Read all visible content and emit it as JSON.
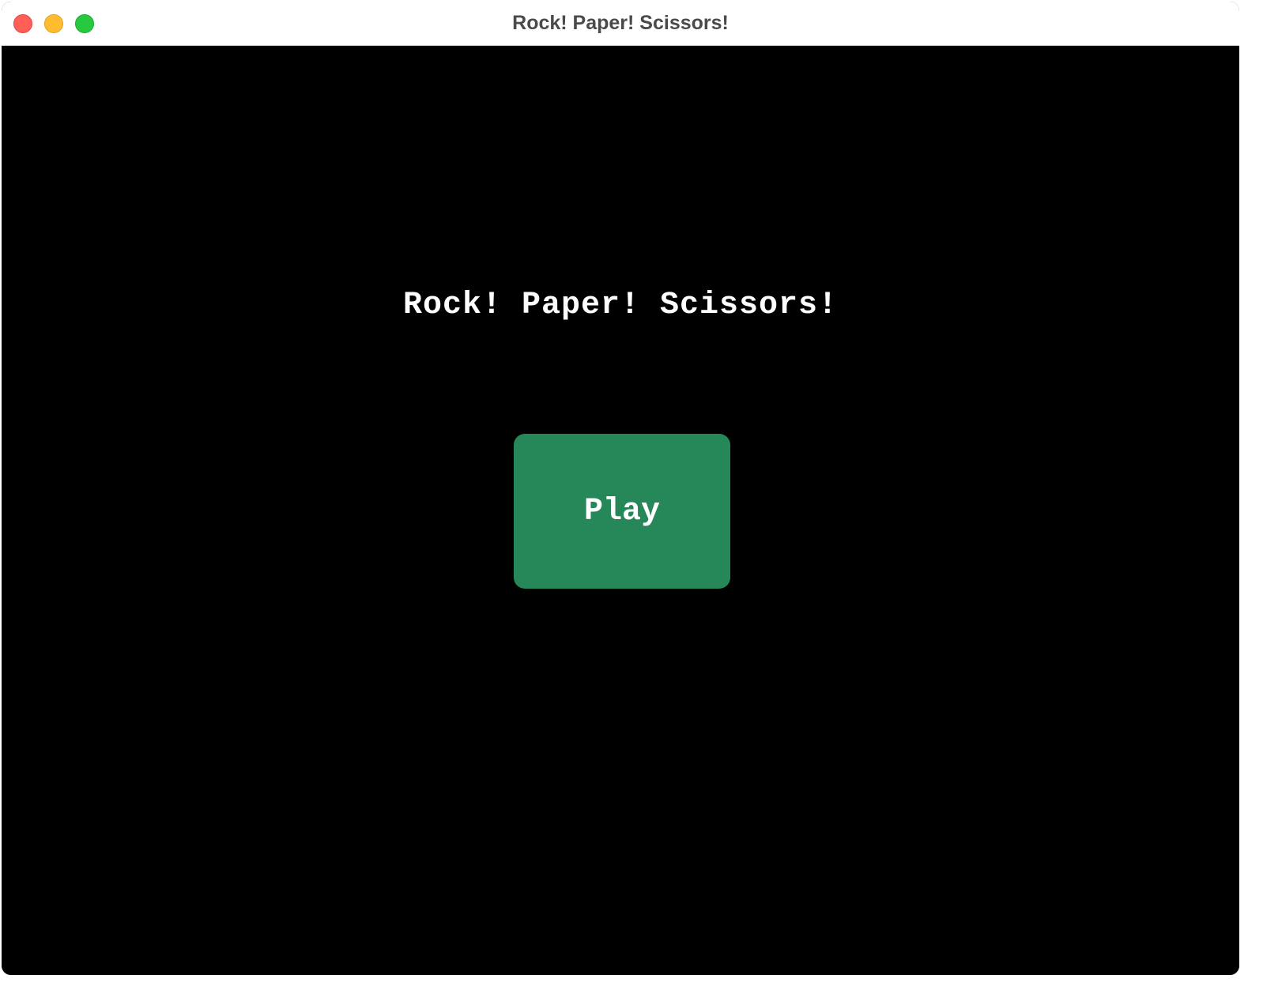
{
  "window": {
    "title": "Rock! Paper! Scissors!",
    "controls": [
      "close-icon",
      "minimize-icon",
      "zoom-icon"
    ]
  },
  "game": {
    "title": "Rock! Paper! Scissors!",
    "play_button_label": "Play",
    "colors": {
      "background": "#000000",
      "title_text": "#ffffff",
      "play_button": "#268758",
      "play_button_text": "#ffffff"
    }
  }
}
